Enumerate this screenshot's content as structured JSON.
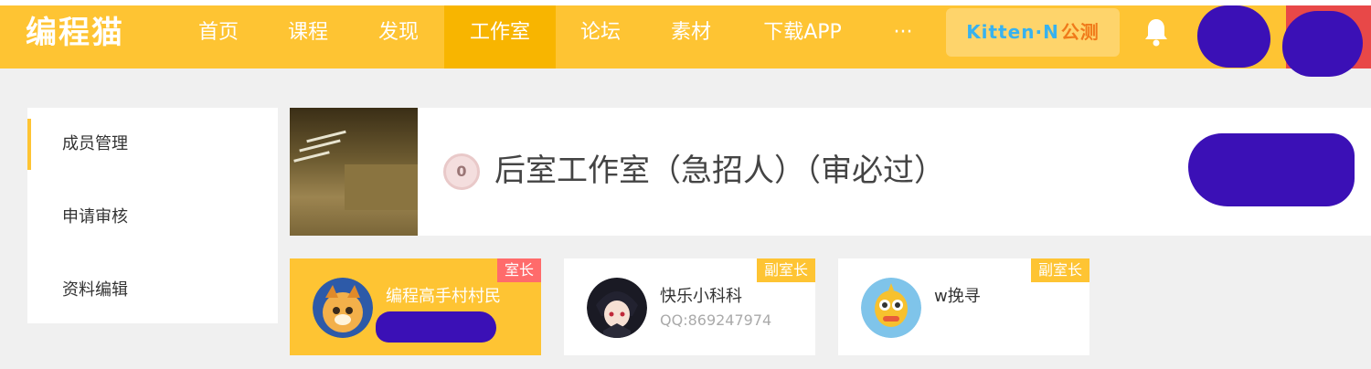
{
  "nav": {
    "logo": "编程猫",
    "items": [
      {
        "label": "首页",
        "active": false
      },
      {
        "label": "课程",
        "active": false
      },
      {
        "label": "发现",
        "active": false
      },
      {
        "label": "工作室",
        "active": true
      },
      {
        "label": "论坛",
        "active": false
      },
      {
        "label": "素材",
        "active": false
      },
      {
        "label": "下载APP",
        "active": false
      },
      {
        "label": "···",
        "active": false
      }
    ],
    "kitten": {
      "brand": "Kitten·N",
      "tag": "公测"
    },
    "bell_icon": "bell-icon",
    "colors": {
      "bar": "#fec433",
      "active": "#f8b500",
      "kitten_bg": "#fed46b",
      "kitten_text": "#37b2ef",
      "kitten_tag": "#f07a1a"
    }
  },
  "sidebar": {
    "items": [
      {
        "label": "成员管理",
        "active": true
      },
      {
        "label": "申请审核",
        "active": false
      },
      {
        "label": "资料编辑",
        "active": false
      }
    ]
  },
  "studio": {
    "level": "0",
    "title": "后室工作室（急招人）（审必过）"
  },
  "members": [
    {
      "role": "室长",
      "name": "编程高手村村民",
      "sub": ""
    },
    {
      "role": "副室长",
      "name": "快乐小科科",
      "sub": "QQ:869247974"
    },
    {
      "role": "副室长",
      "name": "w挽寻",
      "sub": ""
    }
  ]
}
